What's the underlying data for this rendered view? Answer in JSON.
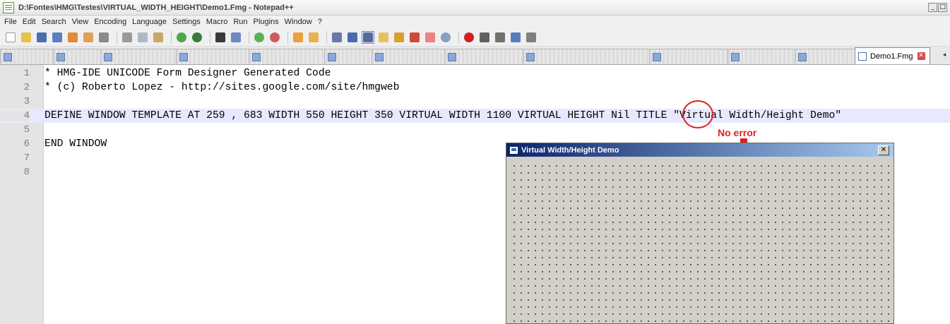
{
  "window": {
    "title": "D:\\Fontes\\HMG\\Testes\\VIRTUAL_WIDTH_HEIGHT\\Demo1.Fmg - Notepad++",
    "minimize": "_",
    "maximize": "□"
  },
  "menu": {
    "items": [
      "File",
      "Edit",
      "Search",
      "View",
      "Encoding",
      "Language",
      "Settings",
      "Macro",
      "Run",
      "Plugins",
      "Window",
      "?"
    ]
  },
  "toolbar": {
    "icons": [
      "new-icon",
      "open-icon",
      "save-icon",
      "save-all-icon",
      "close-icon",
      "close-all-icon",
      "print-icon",
      "cut-icon",
      "copy-icon",
      "paste-icon",
      "undo-icon",
      "redo-icon",
      "find-icon",
      "replace-icon",
      "zoom-in-icon",
      "zoom-out-icon",
      "sync-v-icon",
      "sync-h-icon",
      "wrap-icon",
      "show-all-icon",
      "indent-guide-icon",
      "doc-map-icon",
      "function-list-icon",
      "folder-icon",
      "monitor-icon",
      "record-icon",
      "stop-icon",
      "play-icon",
      "play-multi-icon",
      "save-macro-icon"
    ]
  },
  "tabs": {
    "active_label": "Demo1.Fmg",
    "close": "✕",
    "scroll": "◂"
  },
  "editor": {
    "lines": [
      {
        "num": "1",
        "text": "* HMG-IDE UNICODE Form Designer Generated Code"
      },
      {
        "num": "2",
        "text": "* (c) Roberto Lopez - http://sites.google.com/site/hmgweb"
      },
      {
        "num": "3",
        "text": ""
      },
      {
        "num": "4",
        "text": "DEFINE WINDOW TEMPLATE AT 259 , 683 WIDTH 550 HEIGHT 350 VIRTUAL WIDTH 1100 VIRTUAL HEIGHT Nil TITLE \"Virtual Width/Height Demo\""
      },
      {
        "num": "5",
        "text": ""
      },
      {
        "num": "6",
        "text": "END WINDOW"
      },
      {
        "num": "7",
        "text": ""
      },
      {
        "num": "8",
        "text": ""
      }
    ],
    "current_line": 4
  },
  "annotation": {
    "text": "No error",
    "color": "#e02020"
  },
  "form": {
    "title": "Virtual Width/Height Demo",
    "close": "✕"
  }
}
